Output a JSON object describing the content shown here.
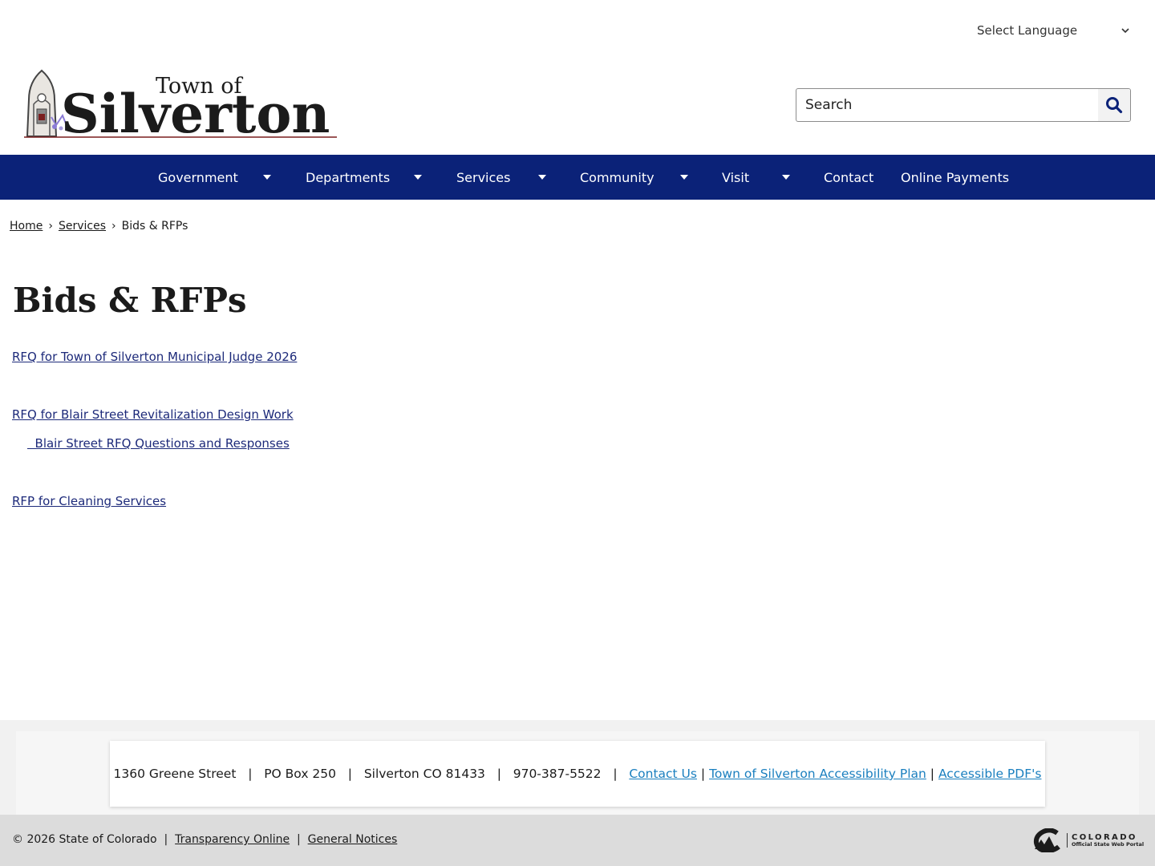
{
  "header": {
    "language_label": "Select Language",
    "logo_line1": "Town of",
    "logo_line2": "Silverton",
    "search_placeholder": "Search"
  },
  "nav": {
    "items": [
      {
        "label": "Government",
        "has_dropdown": true
      },
      {
        "label": "Departments",
        "has_dropdown": true
      },
      {
        "label": "Services",
        "has_dropdown": true
      },
      {
        "label": "Community",
        "has_dropdown": true
      },
      {
        "label": "Visit",
        "has_dropdown": true
      },
      {
        "label": "Contact",
        "has_dropdown": false
      },
      {
        "label": "Online Payments",
        "has_dropdown": false
      }
    ]
  },
  "breadcrumb": {
    "items": [
      "Home",
      "Services",
      "Bids & RFPs"
    ],
    "separator": "›"
  },
  "main": {
    "title": "Bids & RFPs",
    "links": [
      "RFQ for Town of Silverton Municipal Judge 2026",
      "RFQ for Blair Street Revitalization Design Work",
      "  Blair Street RFQ Questions and Responses",
      "RFP for Cleaning Services"
    ]
  },
  "footer": {
    "street": "1360 Greene Street",
    "po_box": "PO Box 250",
    "city": "Silverton CO 81433",
    "phone": "970-387-5522",
    "separator": "|",
    "links": [
      "Contact Us",
      "Town of Silverton Accessibility Plan",
      "Accessible PDF's"
    ],
    "copyright": "© 2026 State of Colorado",
    "bottom_links": [
      "Transparency Online",
      "General Notices"
    ],
    "portal_name": "COLORADO",
    "portal_tagline": "Official State Web Portal"
  },
  "colors": {
    "nav_bg": "#0b2278",
    "link": "#1d2a7a",
    "footer_link": "#1a7fbf",
    "logo_text": "#1b1b1b",
    "logo_accent": "#7a1f1f"
  }
}
